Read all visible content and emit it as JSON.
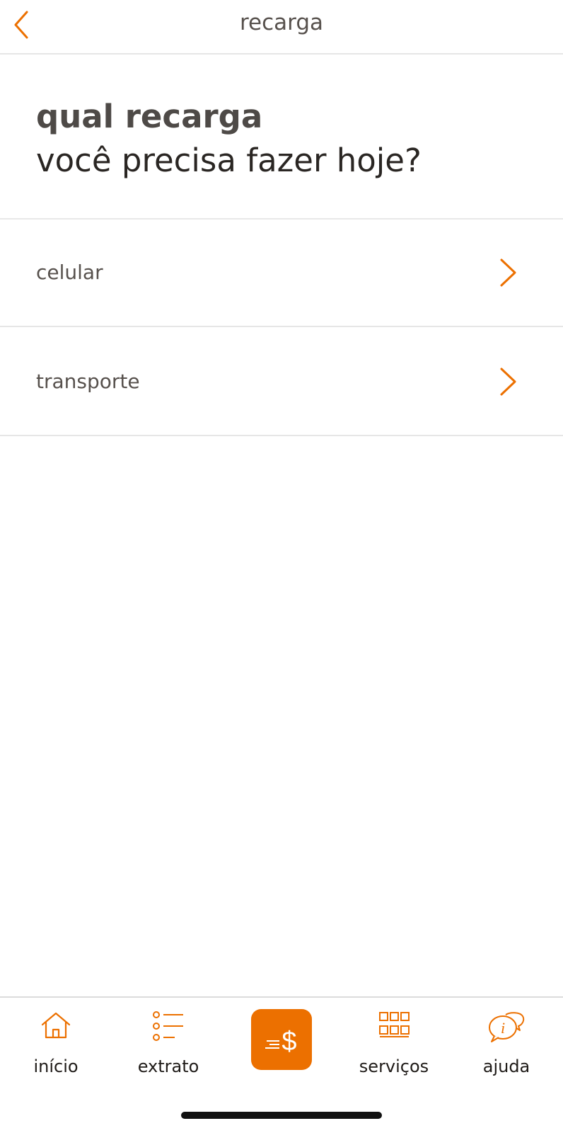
{
  "header": {
    "title": "recarga"
  },
  "heading": {
    "line1": "qual recarga",
    "line2": "você precisa fazer hoje?"
  },
  "list": [
    {
      "label": "celular"
    },
    {
      "label": "transporte"
    }
  ],
  "bottom_nav": {
    "inicio": "início",
    "extrato": "extrato",
    "servicos": "serviços",
    "ajuda": "ajuda"
  },
  "colors": {
    "accent": "#ec7000",
    "text_primary": "#2a2623",
    "text_secondary": "#57514d",
    "divider": "#e6e6e6"
  },
  "icons": [
    "chevron-left-icon",
    "chevron-right-icon",
    "home-icon",
    "list-icon",
    "pay-dollar-icon",
    "grid-icon",
    "help-chat-icon"
  ]
}
